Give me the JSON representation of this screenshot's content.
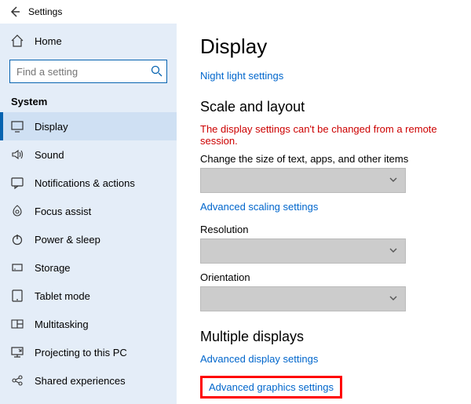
{
  "titlebar": {
    "title": "Settings"
  },
  "sidebar": {
    "home_label": "Home",
    "search_placeholder": "Find a setting",
    "section_label": "System",
    "items": [
      {
        "label": "Display"
      },
      {
        "label": "Sound"
      },
      {
        "label": "Notifications & actions"
      },
      {
        "label": "Focus assist"
      },
      {
        "label": "Power & sleep"
      },
      {
        "label": "Storage"
      },
      {
        "label": "Tablet mode"
      },
      {
        "label": "Multitasking"
      },
      {
        "label": "Projecting to this PC"
      },
      {
        "label": "Shared experiences"
      }
    ]
  },
  "main": {
    "page_title": "Display",
    "night_light_link": "Night light settings",
    "scale_heading": "Scale and layout",
    "remote_error": "The display settings can't be changed from a remote session.",
    "scale_label": "Change the size of text, apps, and other items",
    "advanced_scaling_link": "Advanced scaling settings",
    "resolution_label": "Resolution",
    "orientation_label": "Orientation",
    "multiple_heading": "Multiple displays",
    "advanced_display_link": "Advanced display settings",
    "advanced_graphics_link": "Advanced graphics settings"
  }
}
